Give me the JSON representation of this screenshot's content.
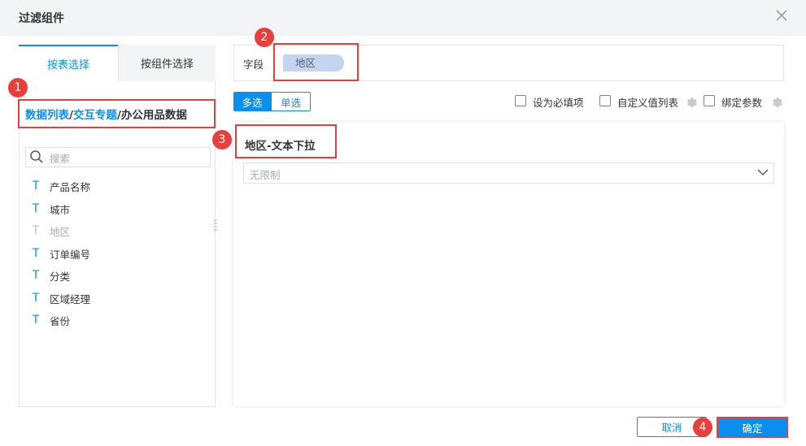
{
  "dialog": {
    "title": "过滤组件"
  },
  "left_panel": {
    "tabs": [
      {
        "label": "按表选择",
        "active": true
      },
      {
        "label": "按组件选择",
        "active": false
      }
    ],
    "path": {
      "part1": "数据列表",
      "sep1": "/",
      "part2": "交互专题",
      "sep2": "/",
      "part3": "办公用品数据"
    },
    "search": {
      "placeholder": "搜索"
    },
    "fields": [
      {
        "label": "产品名称",
        "icon": "text-type-icon",
        "disabled": false
      },
      {
        "label": "城市",
        "icon": "text-type-icon",
        "disabled": false
      },
      {
        "label": "地区",
        "icon": "text-type-icon",
        "disabled": true
      },
      {
        "label": "订单编号",
        "icon": "text-type-icon",
        "disabled": false
      },
      {
        "label": "分类",
        "icon": "text-type-icon",
        "disabled": false
      },
      {
        "label": "区域经理",
        "icon": "text-type-icon",
        "disabled": false
      },
      {
        "label": "省份",
        "icon": "text-type-icon",
        "disabled": false
      }
    ],
    "field_icon_glyph": "T"
  },
  "right_panel": {
    "field_label": "字段",
    "field_tag": "地区",
    "modes": [
      {
        "label": "多选",
        "active": true
      },
      {
        "label": "单选",
        "active": false
      }
    ],
    "options": [
      {
        "label": "设为必填项",
        "checked": false
      },
      {
        "label": "自定义值列表",
        "checked": false,
        "has_settings": true
      },
      {
        "label": "绑定参数",
        "checked": false,
        "has_settings": true
      }
    ],
    "preview": {
      "title": "地区-文本下拉",
      "select_value": "无限制"
    }
  },
  "footer": {
    "cancel_label": "取消",
    "ok_label": "确定"
  },
  "annotations": [
    "1",
    "2",
    "3",
    "4"
  ],
  "colors": {
    "accent": "#0a8ff0",
    "annotation_red": "#e5403b",
    "tag_bg": "#c3d6ef",
    "titlebar_bg": "#f3f4f6"
  }
}
